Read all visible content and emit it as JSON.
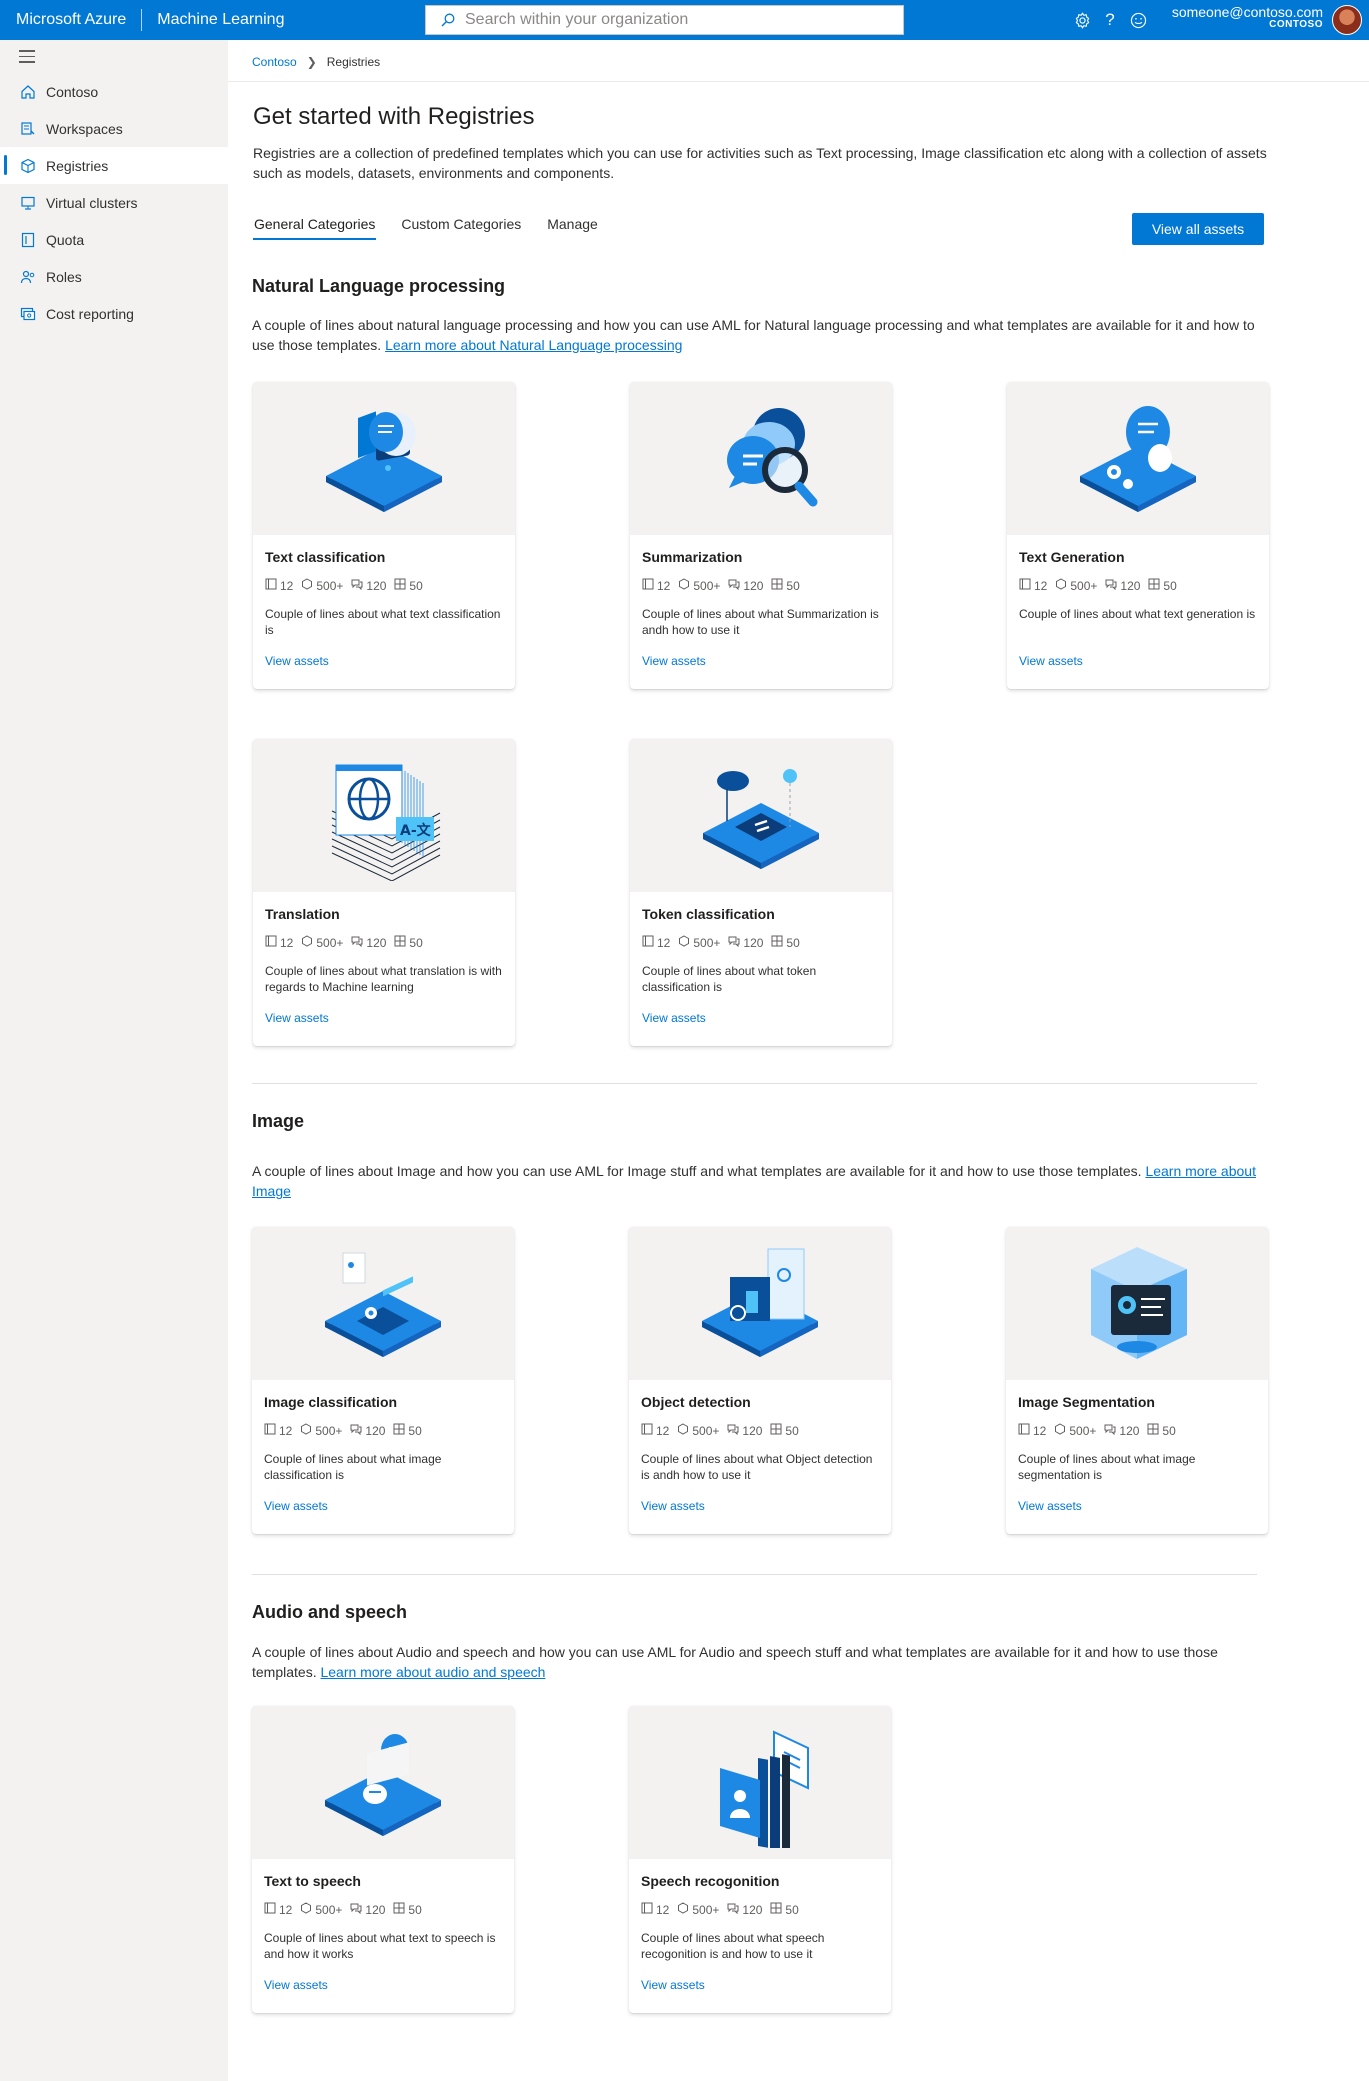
{
  "header": {
    "brand": "Microsoft Azure",
    "product": "Machine Learning",
    "search_placeholder": "Search within your organization",
    "icons": [
      "settings-icon",
      "help-icon",
      "feedback-icon"
    ],
    "account_email": "someone@contoso.com",
    "account_org": "CONTOSO"
  },
  "sidebar": {
    "items": [
      {
        "label": "Contoso",
        "icon": "home-icon"
      },
      {
        "label": "Workspaces",
        "icon": "workspaces-icon"
      },
      {
        "label": "Registries",
        "icon": "registries-icon",
        "active": true
      },
      {
        "label": "Virtual clusters",
        "icon": "virtual-clusters-icon"
      },
      {
        "label": "Quota",
        "icon": "quota-icon"
      },
      {
        "label": "Roles",
        "icon": "roles-icon"
      },
      {
        "label": "Cost reporting",
        "icon": "cost-reporting-icon"
      }
    ]
  },
  "breadcrumb": {
    "root": "Contoso",
    "current": "Registries"
  },
  "page": {
    "title": "Get started with Registries",
    "description": "Registries are a collection of predefined templates which you can use for activities such as Text processing, Image classification etc along with a collection of assets such as models, datasets, environments and components."
  },
  "tabs": [
    "General Categories",
    "Custom Categories",
    "Manage"
  ],
  "view_all_label": "View all assets",
  "colors": {
    "accent": "#0078d4",
    "sidebar_bg": "#f3f2f1",
    "card_image_bg": "#f3f2f1"
  },
  "sections": [
    {
      "title": "Natural Language processing",
      "description": "A couple of lines about natural language processing and how you can use AML for Natural language processing  and what templates are available for it and how to use those templates. ",
      "link": " Learn more about Natural Language processing",
      "cards": [
        {
          "title": "Text classification",
          "stats": [
            "12",
            "500+",
            "120",
            "50"
          ],
          "desc": "Couple of lines about what text classification is",
          "link": "View assets",
          "art": "text-classification"
        },
        {
          "title": "Summarization",
          "stats": [
            "12",
            "500+",
            "120",
            "50"
          ],
          "desc": "Couple of lines about what Summarization is andh how to use it",
          "link": "View assets",
          "art": "summarization"
        },
        {
          "title": "Text Generation",
          "stats": [
            "12",
            "500+",
            "120",
            "50"
          ],
          "desc": "Couple of lines about what text generation is",
          "link": "View assets",
          "art": "text-generation"
        },
        {
          "title": "Translation",
          "stats": [
            "12",
            "500+",
            "120",
            "50"
          ],
          "desc": "Couple of lines about what translation is with regards to Machine learning",
          "link": "View assets",
          "art": "translation"
        },
        {
          "title": "Token classification",
          "stats": [
            "12",
            "500+",
            "120",
            "50"
          ],
          "desc": "Couple of lines about what token classification is",
          "link": "View assets",
          "art": "token-classification"
        }
      ]
    },
    {
      "title": "Image",
      "description": "A couple of lines about Image and how you can use AML for Image stuff  and what templates are available for it and how to use those templates. ",
      "link": " Learn more about Image",
      "cards": [
        {
          "title": "Image classification",
          "stats": [
            "12",
            "500+",
            "120",
            "50"
          ],
          "desc": "Couple of lines about what image classification is",
          "link": "View assets",
          "art": "image-classification"
        },
        {
          "title": "Object detection",
          "stats": [
            "12",
            "500+",
            "120",
            "50"
          ],
          "desc": "Couple of lines about what Object detection is andh how to use it",
          "link": "View assets",
          "art": "object-detection"
        },
        {
          "title": "Image Segmentation",
          "stats": [
            "12",
            "500+",
            "120",
            "50"
          ],
          "desc": "Couple of lines about what image segmentation is",
          "link": "View assets",
          "art": "image-segmentation"
        }
      ]
    },
    {
      "title": "Audio and speech",
      "description": "A couple of lines about Audio and speech and how you can use AML for Audio and speech stuff  and what templates are available for it and how to use those templates. ",
      "link": " Learn more about audio and speech",
      "cards": [
        {
          "title": "Text to speech",
          "stats": [
            "12",
            "500+",
            "120",
            "50"
          ],
          "desc": "Couple of lines about what text to speech is and how it works",
          "link": "View assets",
          "art": "text-to-speech"
        },
        {
          "title": "Speech recogonition",
          "stats": [
            "12",
            "500+",
            "120",
            "50"
          ],
          "desc": "Couple of lines about what speech recogonition is and how to use it",
          "link": "View assets",
          "art": "speech-recognition"
        }
      ]
    }
  ]
}
